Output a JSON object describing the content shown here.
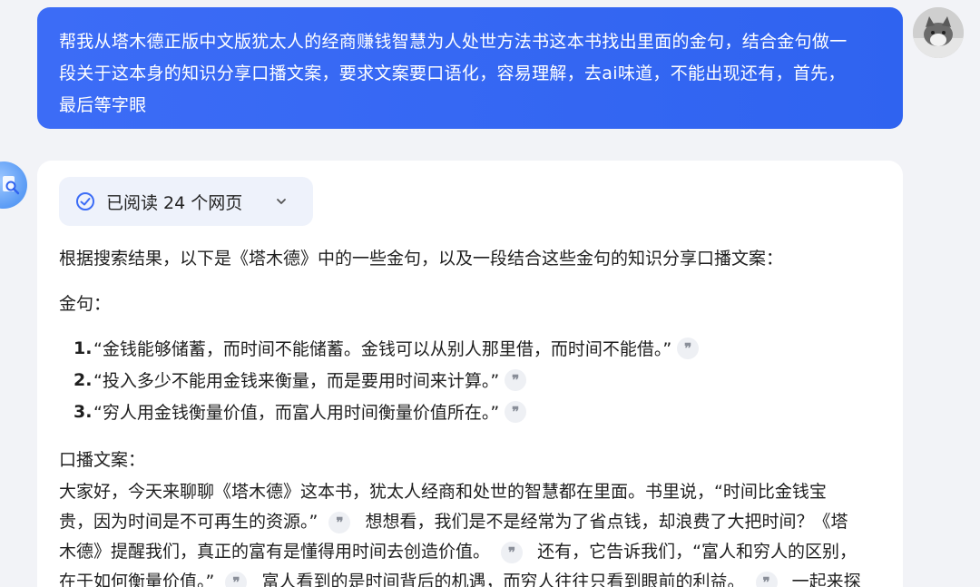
{
  "user": {
    "message_lines": [
      "帮我从塔木德正版中文版犹太人的经商赚钱智慧为人处世方法书这本书找出里面的金句，结合金句做一",
      "段关于这本身的知识分享口播文案，要求文案要口语化，容易理解，去ai味道，不能出现还有，首先，",
      "最后等字眼"
    ]
  },
  "answer": {
    "read_pill": {
      "label": "已阅读 24 个网页"
    },
    "intro": "根据搜索结果，以下是《塔木德》中的一些金句，以及一段结合这些金句的知识分享口播文案：",
    "quotes_heading": "金句：",
    "quotes": [
      {
        "num": "1.",
        "text": "“金钱能够储蓄，而时间不能储蓄。金钱可以从别人那里借，而时间不能借。”"
      },
      {
        "num": "2.",
        "text": "“投入多少不能用金钱来衡量，而是要用时间来计算。”"
      },
      {
        "num": "3.",
        "text": "“穷人用金钱衡量价值，而富人用时间衡量价值所在。”"
      }
    ],
    "script_heading": "口播文案：",
    "script": {
      "line1": "大家好，今天来聊聊《塔木德》这本书，犹太人经商和处世的智慧都在里面。书里说，“时间比金钱宝",
      "line2a": "贵，因为时间是不可再生的资源。”",
      "line2b": "想想看，我们是不是经常为了省点钱，却浪费了大把时间？《塔",
      "line3a": "木德》提醒我们，真正的富有是懂得用时间去创造价值。",
      "line3b": "还有，它告诉我们，“富人和穷人的区别，",
      "line4a": "在于如何衡量价值。”",
      "line4b": "富人看到的是时间背后的机遇，而穷人往往只看到眼前的利益。",
      "line4c": "一起来探"
    },
    "quote_icon_glyph": "❞"
  }
}
